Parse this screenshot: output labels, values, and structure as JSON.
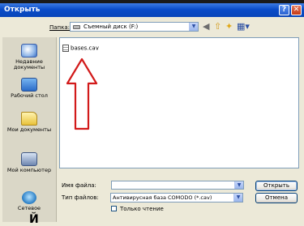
{
  "window": {
    "title": "Открыть",
    "help_label": "?",
    "close_label": "✕"
  },
  "toolbar": {
    "folder_label": "Папка:",
    "folder_value": "Съемный диск (F:)",
    "nav_icons": [
      "back-icon",
      "up-folder-icon",
      "new-folder-icon",
      "views-icon"
    ]
  },
  "places": [
    {
      "label": "Недавние документы",
      "icon": "recent-documents-icon"
    },
    {
      "label": "Рабочий стол",
      "icon": "desktop-icon"
    },
    {
      "label": "Мои документы",
      "icon": "my-documents-icon"
    },
    {
      "label": "Мой компьютер",
      "icon": "my-computer-icon"
    },
    {
      "label": "Сетевое",
      "icon": "network-icon"
    }
  ],
  "files": [
    {
      "name": "bases.cav",
      "icon": "document-icon"
    }
  ],
  "annotation": {
    "arrow_color": "#d21a1a"
  },
  "footer": {
    "filename_label": "Имя файла:",
    "filename_value": "",
    "filetype_label": "Тип файлов:",
    "filetype_value": "Антивирусная база COMODO (*.cav)",
    "open_button": "Открыть",
    "cancel_button": "Отмена",
    "readonly_label": "Только чтение"
  },
  "caption": "Й"
}
